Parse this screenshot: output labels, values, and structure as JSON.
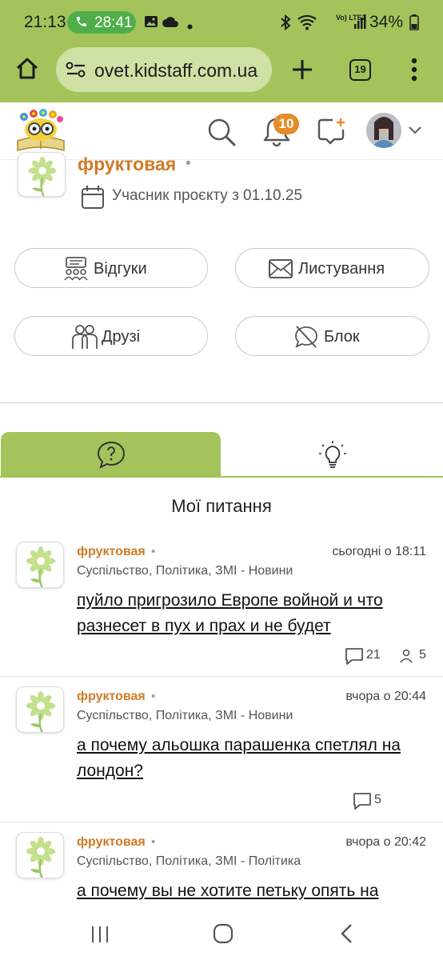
{
  "status_bar": {
    "time": "21:13",
    "call_timer": "28:41",
    "network": "Vo) LTE2",
    "battery": "34%"
  },
  "browser": {
    "url": "ovet.kidstaff.com.ua",
    "tab_count": "19"
  },
  "site_header": {
    "notification_count": "10"
  },
  "profile": {
    "name": "фруктовая",
    "dot": "•",
    "member_since": "Учасник проєкту з 01.10.25",
    "buttons": {
      "reviews": "Відгуки",
      "messages": "Листування",
      "friends": "Друзі",
      "block": "Блок"
    }
  },
  "section_title": "Мої питання",
  "questions": [
    {
      "author": "фруктовая",
      "dot": "•",
      "time": "сьогодні о 18:11",
      "category": "Суспільство, Політика, ЗМІ - Новини",
      "title": "пуйло пригрозило Европе войной и что разнесет в пух и прах и не будет",
      "comments": "21",
      "users": "5"
    },
    {
      "author": "фруктовая",
      "dot": "•",
      "time": "вчора о 20:44",
      "category": "Суспільство, Політика, ЗМІ - Новини",
      "title": "а почему альошка парашенка спетлял на лондон?",
      "comments": "5"
    },
    {
      "author": "фруктовая",
      "dot": "•",
      "time": "вчора о 20:42",
      "category": "Суспільство, Політика, ЗМІ - Політика",
      "title": "а почему вы не хотите петьку опять на"
    }
  ],
  "colors": {
    "brand_green": "#a4c45b",
    "accent_orange": "#d07a26",
    "badge_orange": "#e48b2a"
  }
}
